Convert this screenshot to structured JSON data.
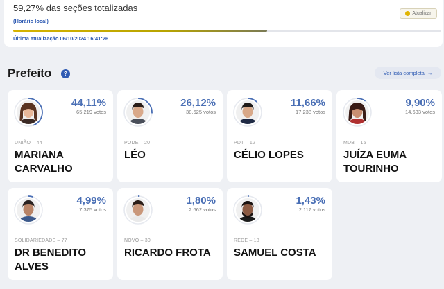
{
  "progress": {
    "title": "59,27% das seções totalizadas",
    "subtitle": "(Horário local)",
    "fill_fraction": 0.5927,
    "update_button": "Atualizar",
    "last_update": "Última atualização 06/10/2024 16:41:26"
  },
  "section": {
    "title": "Prefeito",
    "help_icon": "?",
    "see_all": "Ver lista completa",
    "see_all_arrow": "→"
  },
  "candidates": [
    {
      "pct": "44,11%",
      "votes": "65.219 votos",
      "party": "UNIÃO – 44",
      "name": "Mariana Carvalho",
      "share": 0.4411,
      "skin": "#e8b89a",
      "hair": "#5a3422",
      "shirt": "#3b2a25",
      "hair_style": "long"
    },
    {
      "pct": "26,12%",
      "votes": "38.625 votos",
      "party": "PODE – 20",
      "name": "Léo",
      "share": 0.2612,
      "skin": "#d9a98a",
      "hair": "#2a1d18",
      "shirt": "#4a4f5a",
      "hair_style": "short"
    },
    {
      "pct": "11,66%",
      "votes": "17.238 votos",
      "party": "PDT – 12",
      "name": "Célio Lopes",
      "share": 0.1166,
      "skin": "#d8a888",
      "hair": "#1e1a18",
      "shirt": "#1f2a44",
      "hair_style": "short"
    },
    {
      "pct": "9,90%",
      "votes": "14.633 votos",
      "party": "MDB – 15",
      "name": "Juíza Euma Tourinho",
      "share": 0.099,
      "skin": "#c98f72",
      "hair": "#3a1c16",
      "shirt": "#b03030",
      "hair_style": "long"
    },
    {
      "pct": "4,99%",
      "votes": "7.375 votos",
      "party": "SOLIDARIEDADE – 77",
      "name": "Dr Benedito Alves",
      "share": 0.0499,
      "skin": "#b88366",
      "hair": "#2a2220",
      "shirt": "#3d5a8c",
      "hair_style": "short"
    },
    {
      "pct": "1,80%",
      "votes": "2.662 votos",
      "party": "NOVO – 30",
      "name": "Ricardo Frota",
      "share": 0.018,
      "skin": "#c9977a",
      "hair": "#2b1e18",
      "shirt": "#e9e9e9",
      "hair_style": "short"
    },
    {
      "pct": "1,43%",
      "votes": "2.117 votos",
      "party": "REDE – 18",
      "name": "Samuel Costa",
      "share": 0.0143,
      "skin": "#8c5a42",
      "hair": "#1a1210",
      "shirt": "#1c1c1c",
      "hair_style": "beard"
    }
  ],
  "colors": {
    "accent": "#2f5bb3",
    "ring": "#4a6fb5",
    "ring_track": "#e6e9ef",
    "progress_bar": "#c9b000"
  }
}
